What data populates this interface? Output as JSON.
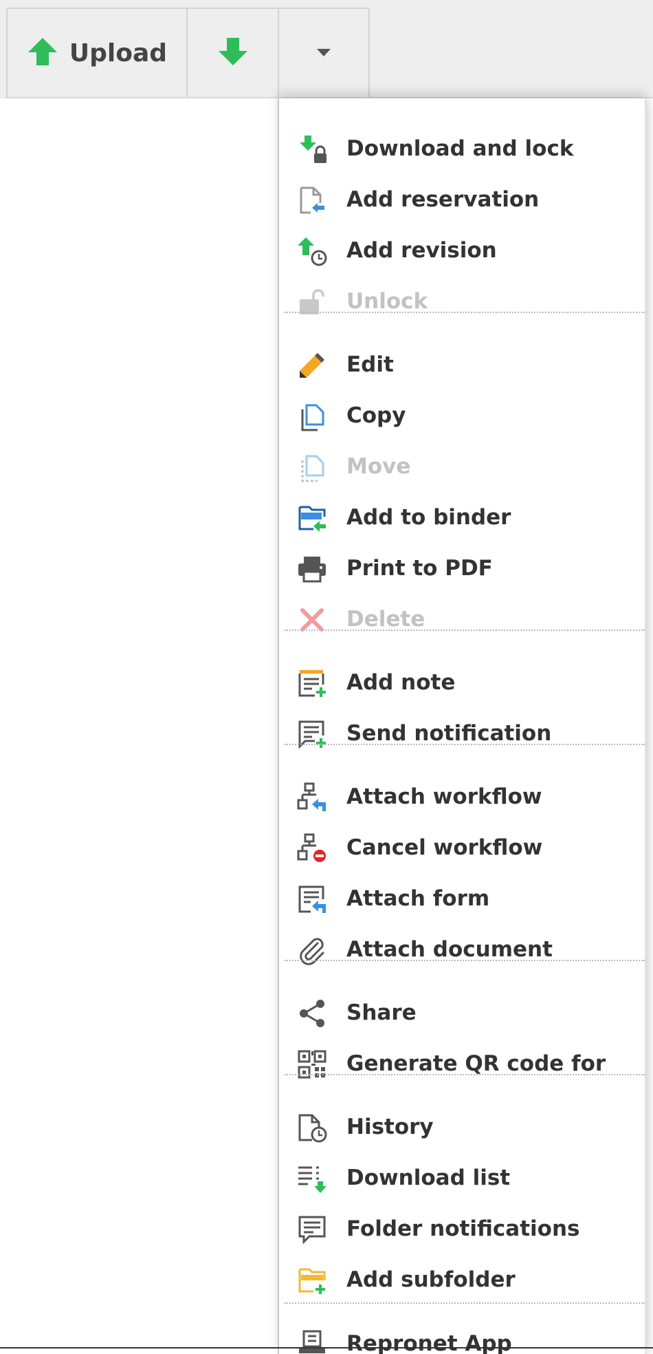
{
  "toolbar": {
    "upload_label": "Upload"
  },
  "menu": {
    "items": [
      {
        "label": "Download and lock",
        "icon": "download-lock-icon",
        "enabled": true
      },
      {
        "label": "Add reservation",
        "icon": "add-reservation-icon",
        "enabled": true
      },
      {
        "label": "Add revision",
        "icon": "add-revision-icon",
        "enabled": true
      },
      {
        "label": "Unlock",
        "icon": "unlock-icon",
        "enabled": false
      },
      {
        "label": "Edit",
        "icon": "pencil-icon",
        "enabled": true
      },
      {
        "label": "Copy",
        "icon": "copy-icon",
        "enabled": true
      },
      {
        "label": "Move",
        "icon": "move-icon",
        "enabled": false
      },
      {
        "label": "Add to binder",
        "icon": "add-to-binder-icon",
        "enabled": true
      },
      {
        "label": "Print to PDF",
        "icon": "printer-icon",
        "enabled": true
      },
      {
        "label": "Delete",
        "icon": "delete-icon",
        "enabled": false
      },
      {
        "label": "Add note",
        "icon": "add-note-icon",
        "enabled": true
      },
      {
        "label": "Send notification",
        "icon": "send-notification-icon",
        "enabled": true
      },
      {
        "label": "Attach workflow",
        "icon": "attach-workflow-icon",
        "enabled": true
      },
      {
        "label": "Cancel workflow",
        "icon": "cancel-workflow-icon",
        "enabled": true
      },
      {
        "label": "Attach form",
        "icon": "attach-form-icon",
        "enabled": true
      },
      {
        "label": "Attach document",
        "icon": "paperclip-icon",
        "enabled": true
      },
      {
        "label": "Share",
        "icon": "share-icon",
        "enabled": true
      },
      {
        "label": "Generate QR code for",
        "icon": "qr-code-icon",
        "enabled": true
      },
      {
        "label": "History",
        "icon": "history-icon",
        "enabled": true
      },
      {
        "label": "Download list",
        "icon": "download-list-icon",
        "enabled": true
      },
      {
        "label": "Folder notifications",
        "icon": "folder-notifications-icon",
        "enabled": true
      },
      {
        "label": "Add subfolder",
        "icon": "add-subfolder-icon",
        "enabled": true
      },
      {
        "label": "Repronet App",
        "icon": "repronet-app-icon",
        "enabled": true
      }
    ]
  },
  "colors": {
    "green": "#2ebd5a",
    "blue": "#3a8fe0",
    "dark_blue": "#1f5fa8",
    "gray_icon": "#555555",
    "orange": "#f5a623",
    "yellow": "#f5b82e",
    "red": "#e0262a",
    "disabled_text": "#c2c2c2"
  }
}
